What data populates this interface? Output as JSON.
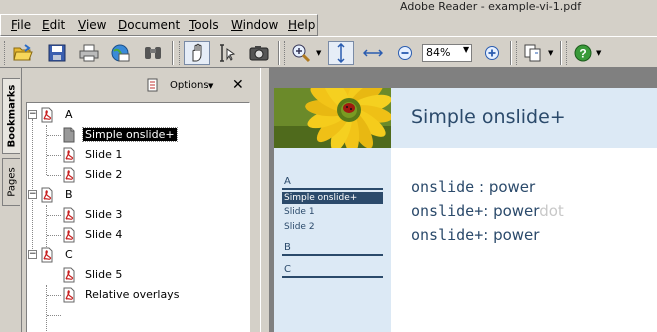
{
  "window": {
    "title": "Adobe Reader - example-vi-1.pdf"
  },
  "menu": [
    {
      "key": "F",
      "rest": "ile"
    },
    {
      "key": "E",
      "rest": "dit"
    },
    {
      "key": "V",
      "rest": "iew"
    },
    {
      "key": "D",
      "rest": "ocument"
    },
    {
      "key": "T",
      "rest": "ools"
    },
    {
      "key": "W",
      "rest": "indow"
    },
    {
      "key": "H",
      "rest": "elp"
    }
  ],
  "toolbar": {
    "zoom_value": "84%",
    "icons": [
      "open-icon",
      "save-icon",
      "print-icon",
      "email-icon",
      "search-icon",
      "hand-tool-icon",
      "select-text-icon",
      "snapshot-icon",
      "zoom-in-tool-icon",
      "fit-page-icon",
      "fit-width-icon",
      "zoom-out-icon",
      "zoom-plus-icon",
      "pages-tool-icon",
      "help-icon"
    ]
  },
  "side_tabs": {
    "bookmarks": "Bookmarks",
    "pages": "Pages"
  },
  "bookmarks_panel": {
    "options_label": "Options",
    "close_glyph": "✕",
    "items": [
      {
        "label": "A",
        "level": 0,
        "expander": "−",
        "selected": false
      },
      {
        "label": "Simple onslide+",
        "level": 1,
        "selected": true
      },
      {
        "label": "Slide 1",
        "level": 1,
        "selected": false
      },
      {
        "label": "Slide 2",
        "level": 1,
        "selected": false
      },
      {
        "label": "B",
        "level": 0,
        "expander": "−",
        "selected": false
      },
      {
        "label": "Slide 3",
        "level": 1,
        "selected": false
      },
      {
        "label": "Slide 4",
        "level": 1,
        "selected": false
      },
      {
        "label": "C",
        "level": 0,
        "expander": "−",
        "selected": false
      },
      {
        "label": "Slide 5",
        "level": 1,
        "selected": false
      },
      {
        "label": "Relative overlays",
        "level": 1,
        "selected": false
      }
    ]
  },
  "slide": {
    "title": "Simple onslide+",
    "nav": {
      "sections": [
        "A",
        "B",
        "C"
      ],
      "items_a": [
        "Simple onslide+",
        "Slide 1",
        "Slide 2"
      ]
    },
    "lines": [
      {
        "cmd": "onslide",
        "sep": " : ",
        "text": "power",
        "ghost": ""
      },
      {
        "cmd": "onslide+",
        "sep": ": ",
        "text": "power",
        "ghost": "dot"
      },
      {
        "cmd": "onslide+",
        "sep": ": ",
        "text": "power",
        "ghost": ""
      }
    ],
    "colors": {
      "accent": "#2b4a6b",
      "sidebar": "#dce9f5",
      "ghost": "#c8c8c8"
    }
  }
}
